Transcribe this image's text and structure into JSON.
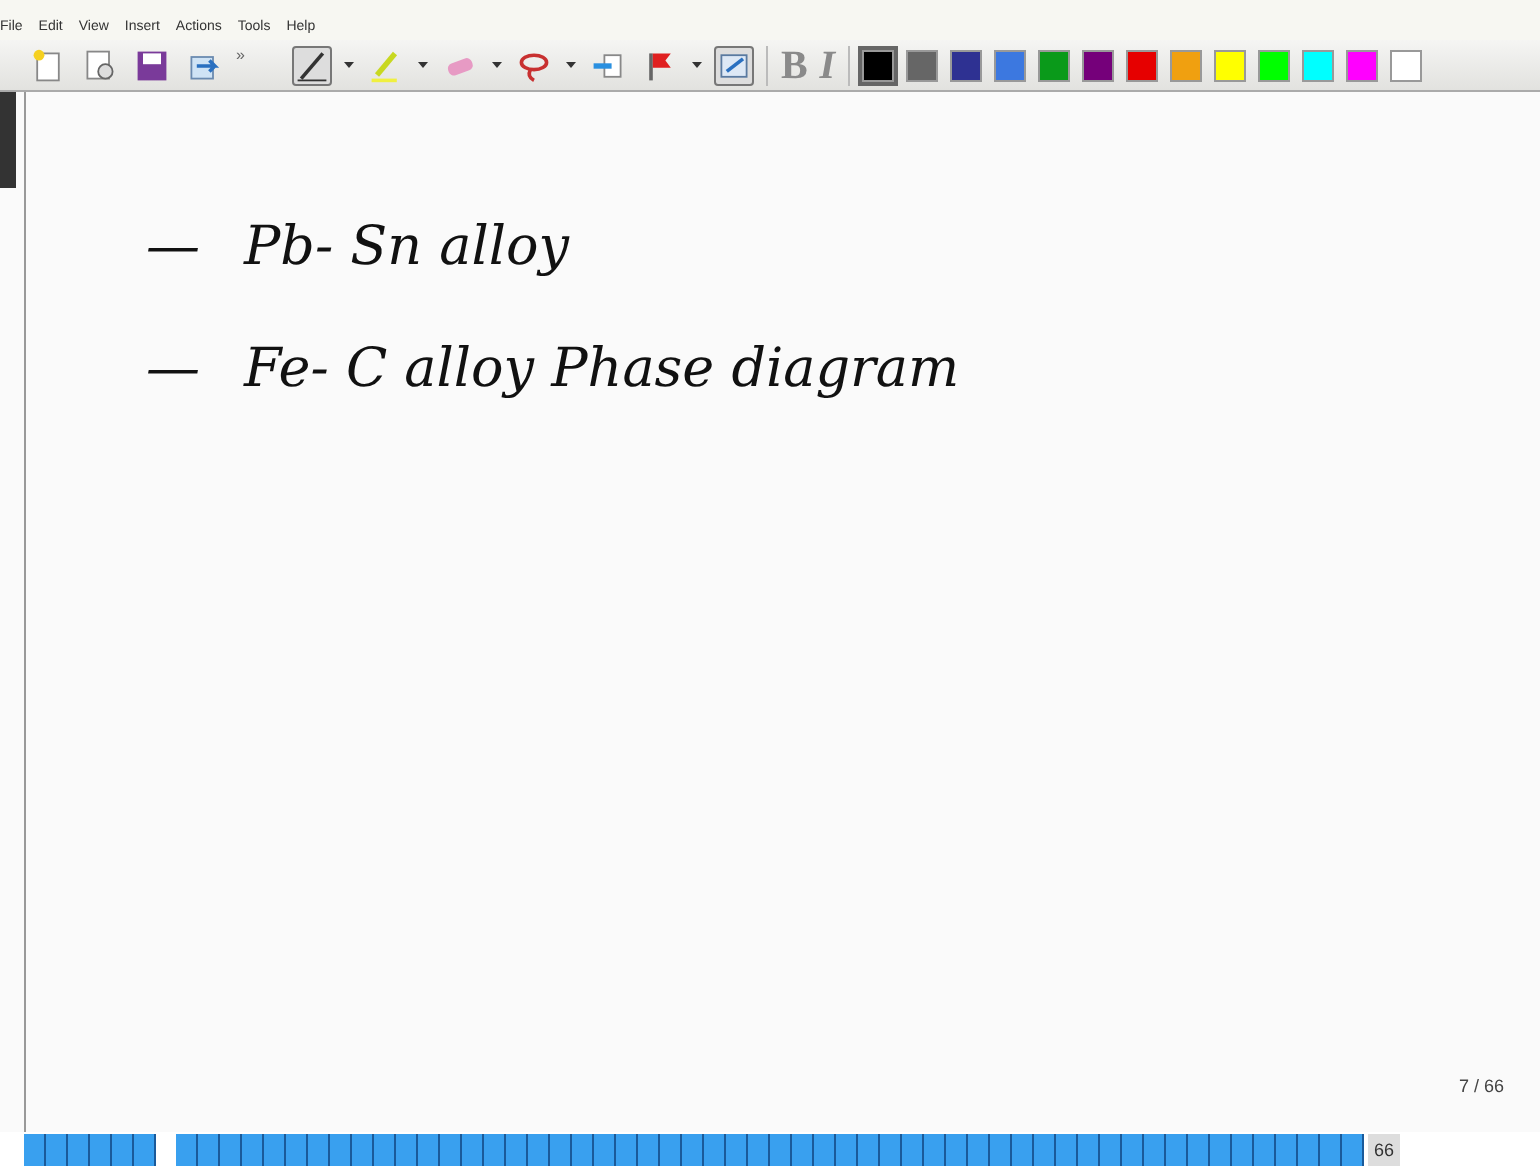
{
  "menu": [
    "File",
    "Edit",
    "View",
    "Insert",
    "Actions",
    "Tools",
    "Help"
  ],
  "file_tools": [
    {
      "kind": "new"
    },
    {
      "kind": "template"
    },
    {
      "kind": "save"
    },
    {
      "kind": "send"
    }
  ],
  "overflow": "»",
  "tools": [
    {
      "kind": "pen",
      "selected": true
    },
    {
      "kind": "highlighter",
      "selected": false
    },
    {
      "kind": "eraser",
      "selected": false
    },
    {
      "kind": "lasso",
      "selected": false
    },
    {
      "kind": "insert-space",
      "selected": false
    },
    {
      "kind": "flag",
      "selected": false
    },
    {
      "kind": "selection",
      "selected": true
    }
  ],
  "format": [
    "B",
    "I"
  ],
  "palette": [
    {
      "color": "#000000",
      "selected": true
    },
    {
      "color": "#666666",
      "selected": false
    },
    {
      "color": "#2e3192",
      "selected": false
    },
    {
      "color": "#3c78e0",
      "selected": false
    },
    {
      "color": "#0a9a1a",
      "selected": false
    },
    {
      "color": "#75007a",
      "selected": false
    },
    {
      "color": "#e60000",
      "selected": false
    },
    {
      "color": "#f0a010",
      "selected": false
    },
    {
      "color": "#ffff00",
      "selected": false
    },
    {
      "color": "#00ff00",
      "selected": false
    },
    {
      "color": "#00ffff",
      "selected": false
    },
    {
      "color": "#ff00ff",
      "selected": false
    },
    {
      "color": "#ffffff",
      "selected": false
    }
  ],
  "ink": [
    {
      "dash": "—",
      "text": "Pb- Sn alloy"
    },
    {
      "dash": "—",
      "text": "Fe- C alloy Phase diagram"
    }
  ],
  "page_indicator": "7 / 66",
  "page_count": "66"
}
